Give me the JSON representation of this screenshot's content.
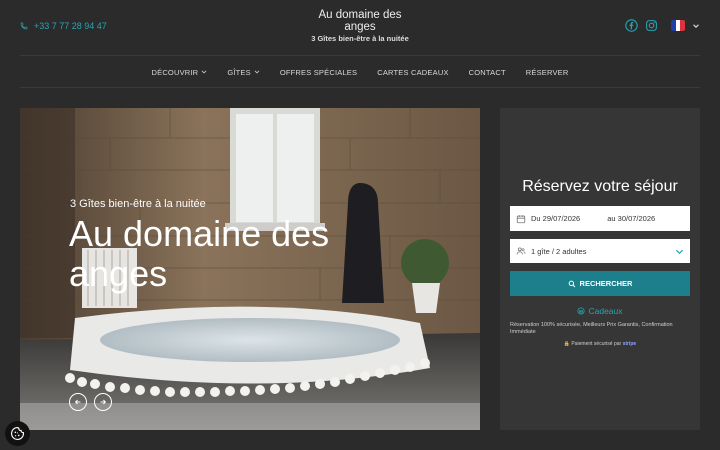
{
  "header": {
    "phone": "+33 7 77 28 94 47",
    "brand_title": "Au domaine des anges",
    "brand_subtitle": "3 Gîtes bien-être à la nuitée",
    "social_icons": [
      "facebook-icon",
      "instagram-icon"
    ],
    "language_flag": "fr-flag"
  },
  "nav": {
    "items": [
      {
        "label": "DÉCOUVRIR",
        "has_dropdown": true
      },
      {
        "label": "GÎTES",
        "has_dropdown": true
      },
      {
        "label": "OFFRES SPÉCIALES",
        "has_dropdown": false
      },
      {
        "label": "CARTES CADEAUX",
        "has_dropdown": false
      },
      {
        "label": "CONTACT",
        "has_dropdown": false
      },
      {
        "label": "RÉSERVER",
        "has_dropdown": false
      }
    ]
  },
  "hero": {
    "subtitle": "3 Gîtes bien-être à la nuitée",
    "title": "Au domaine des anges"
  },
  "booking": {
    "title": "Réservez votre séjour",
    "date_from": "Du 29/07/2026",
    "date_to": "au 30/07/2026",
    "guests": "1 gîte / 2 adultes",
    "search_label": "RECHERCHER",
    "gift_label": "Cadeaux",
    "info": "Réservation 100% sécurisée, Meilleurs Prix Garantis, Confirmation Immédiate",
    "payment_prefix": "Paiement sécurisé par",
    "payment_brand": "stripe"
  },
  "colors": {
    "background": "#2b2b2b",
    "panel": "#363636",
    "accent": "#1d7f8c",
    "link": "#29a3b3"
  }
}
